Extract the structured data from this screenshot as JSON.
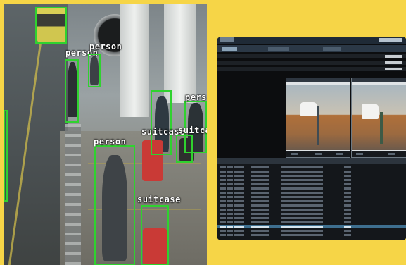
{
  "left_panel": {
    "detections": [
      {
        "label": "person",
        "color": "#2fd22f"
      },
      {
        "label": "person",
        "color": "#2fd22f"
      },
      {
        "label": "pers",
        "color": "#2fd22f"
      },
      {
        "label": "suitcase",
        "color": "#2fd22f"
      },
      {
        "label": "suitca",
        "color": "#2fd22f"
      },
      {
        "label": "person",
        "color": "#2fd22f"
      },
      {
        "label": "suitcase",
        "color": "#2fd22f"
      }
    ]
  },
  "colors": {
    "background": "#f6d547",
    "bbox": "#2fd22f",
    "monitor": "#0c0d0f",
    "selected_row": "#3e6f8f"
  }
}
